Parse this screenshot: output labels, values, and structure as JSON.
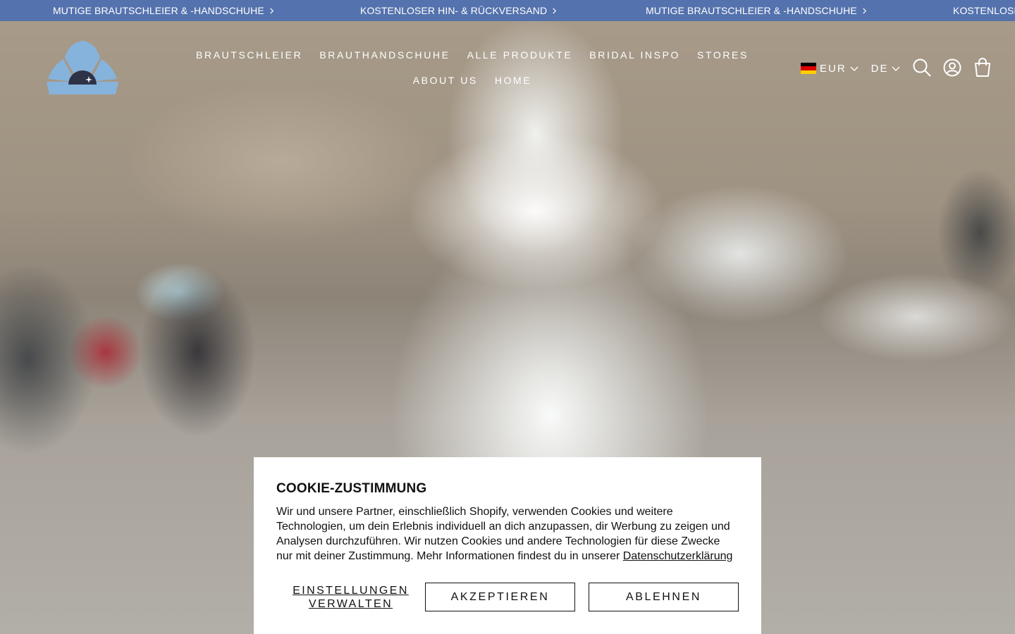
{
  "announcement": {
    "background": "#5472ad",
    "items": [
      "MUTIGE BRAUTSCHLEIER & -HANDSCHUHE",
      "KOSTENLOSER HIN- & RÜCKVERSAND",
      "MUTIGE BRAUTSCHLEIER & -HANDSCHUHE",
      "KOSTENLOSER HIN- & RÜCKVERSAND"
    ],
    "arrow_icon": "chevron-right-icon"
  },
  "header": {
    "logo_icon": "seashell-logo",
    "logo_color": "#86b3dc",
    "nav": [
      "BRAUTSCHLEIER",
      "BRAUTHANDSCHUHE",
      "ALLE PRODUKTE",
      "BRIDAL INSPO",
      "STORES",
      "ABOUT US",
      "HOME"
    ],
    "currency": "EUR",
    "language": "DE",
    "icons": [
      "search-icon",
      "account-icon",
      "cart-icon"
    ]
  },
  "cookie": {
    "title": "COOKIE-ZUSTIMMUNG",
    "text": "Wir und unsere Partner, einschließlich Shopify, verwenden Cookies und weitere Technologien, um dein Erlebnis individuell an dich anzupassen, dir Werbung zu zeigen und Analysen durchzuführen. Wir nutzen Cookies und andere Technologien für diese Zwecke nur mit deiner Zustimmung. Mehr Informationen findest du in unserer",
    "link": "Datenschutzerklärung",
    "manage_label": "EINSTELLUNGEN VERWALTEN",
    "accept_label": "AKZEPTIEREN",
    "decline_label": "ABLEHNEN"
  }
}
